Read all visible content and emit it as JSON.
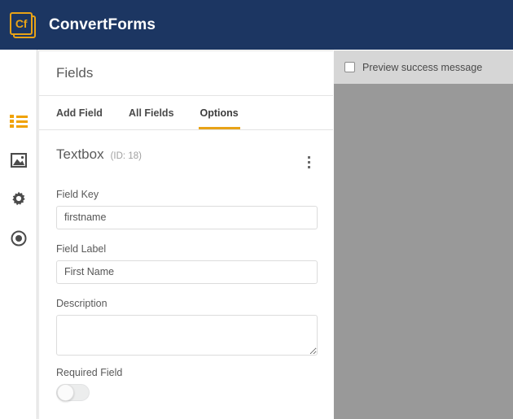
{
  "header": {
    "logo_text": "Cf",
    "logo_icon": "convertforms-logo-icon",
    "brand": "ConvertForms",
    "bg_color": "#1c3662",
    "accent_color": "#e8a317"
  },
  "sidebar": {
    "items": [
      {
        "icon": "list-icon",
        "active": true
      },
      {
        "icon": "image-icon",
        "active": false
      },
      {
        "icon": "gear-icon",
        "active": false
      },
      {
        "icon": "radio-target-icon",
        "active": false
      }
    ]
  },
  "panel": {
    "title": "Fields",
    "tabs": [
      {
        "label": "Add Field",
        "active": false
      },
      {
        "label": "All Fields",
        "active": false
      },
      {
        "label": "Options",
        "active": true
      }
    ],
    "field": {
      "type": "Textbox",
      "id_label": "(ID: 18)",
      "menu_icon": "kebab-menu-icon",
      "field_key": {
        "label": "Field Key",
        "value": "firstname",
        "placeholder": ""
      },
      "field_label": {
        "label": "Field Label",
        "value": "First Name",
        "placeholder": ""
      },
      "description": {
        "label": "Description",
        "value": "",
        "placeholder": ""
      },
      "required": {
        "label": "Required Field",
        "checked": false
      }
    }
  },
  "preview": {
    "checkbox_label": "Preview success message",
    "checkbox_checked": false,
    "bar_color": "#d6d6d6",
    "canvas_color": "#999999"
  }
}
